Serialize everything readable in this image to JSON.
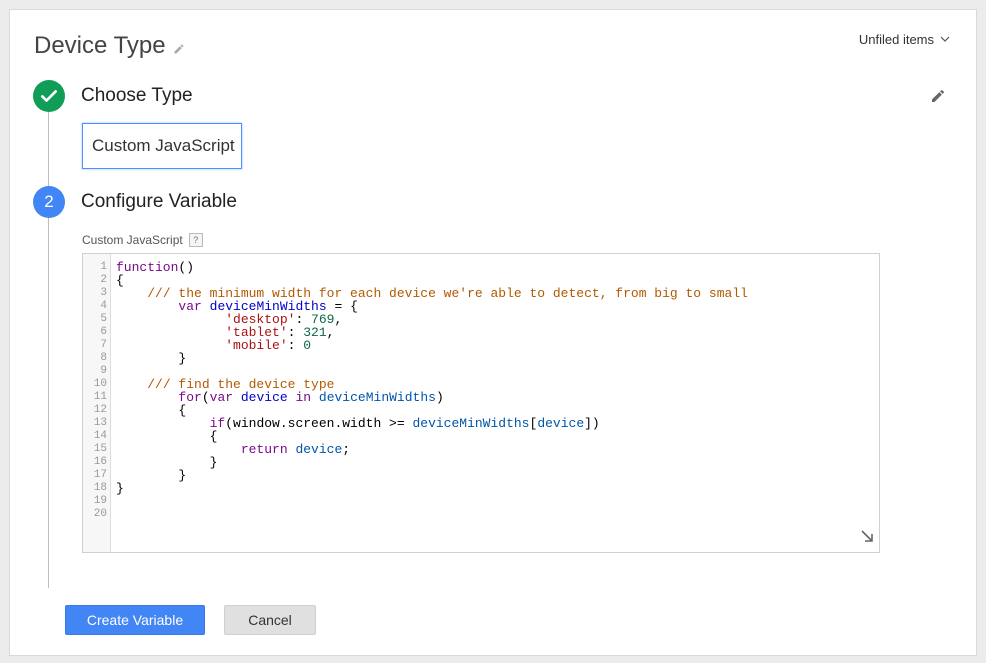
{
  "header": {
    "title": "Device Type",
    "folder_label": "Unfiled items"
  },
  "steps": [
    {
      "number": "",
      "title": "Choose Type",
      "status": "complete"
    },
    {
      "number": "2",
      "title": "Configure Variable",
      "status": "active"
    }
  ],
  "choose_type": {
    "selected": "Custom JavaScript"
  },
  "configure": {
    "field_label": "Custom JavaScript",
    "help_glyph": "?",
    "code_lines": [
      "function()",
      "{",
      "    /// the minimum width for each device we're able to detect, from big to small",
      "        var deviceMinWidths = {",
      "              'desktop': 769,",
      "              'tablet': 321,",
      "              'mobile': 0",
      "        }",
      "",
      "    /// find the device type",
      "        for(var device in deviceMinWidths)",
      "        {",
      "            if(window.screen.width >= deviceMinWidths[device])",
      "            {",
      "                return device;",
      "            }",
      "        }",
      "}",
      "",
      ""
    ]
  },
  "actions": {
    "create_label": "Create Variable",
    "cancel_label": "Cancel"
  },
  "colors": {
    "accent": "#4285f4",
    "success": "#0f9d58"
  },
  "icons": {
    "title_edit": "pencil-icon",
    "step_complete": "check-icon",
    "edit_step": "pencil-icon",
    "folder_dropdown": "chevron-down-icon",
    "resize": "resize-arrow-icon"
  }
}
